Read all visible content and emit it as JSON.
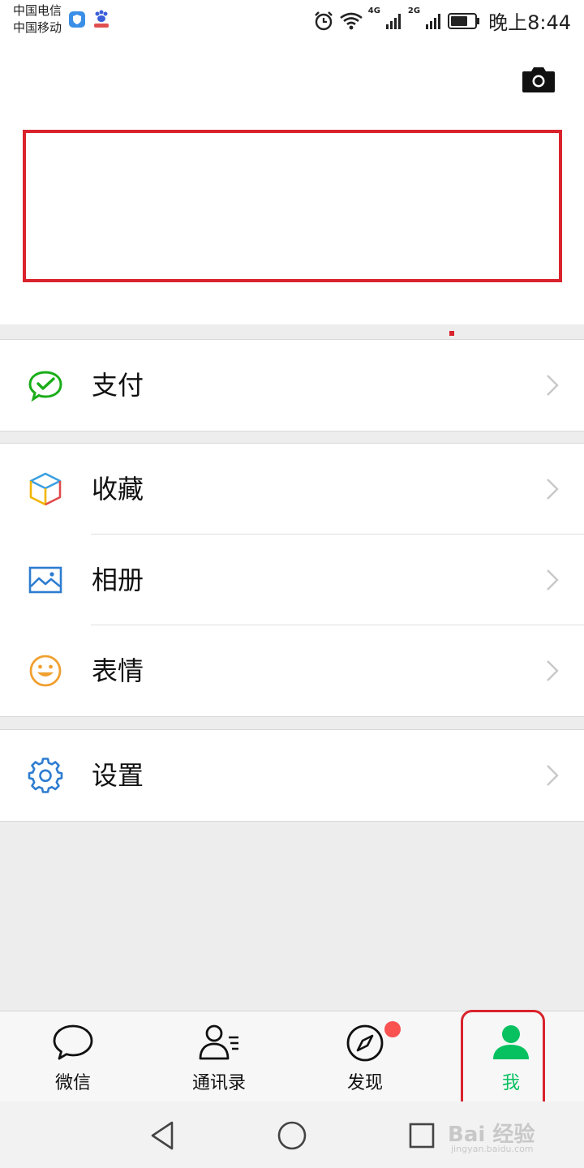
{
  "status_bar": {
    "carrier_1": "中国电信",
    "carrier_2": "中国移动",
    "net_1": "4G",
    "net_2": "2G",
    "time": "晚上8:44",
    "battery_level": 0.7
  },
  "header": {
    "camera_icon": "camera-icon"
  },
  "menu": {
    "group1": [
      {
        "label": "支付",
        "icon": "wechat-pay-icon",
        "color": "#1aad19"
      }
    ],
    "group2": [
      {
        "label": "收藏",
        "icon": "favorites-cube-icon",
        "color": "#f0b400"
      },
      {
        "label": "相册",
        "icon": "album-icon",
        "color": "#2d7cd1"
      },
      {
        "label": "表情",
        "icon": "sticker-smile-icon",
        "color": "#f0a030"
      }
    ],
    "group3": [
      {
        "label": "设置",
        "icon": "settings-gear-icon",
        "color": "#2d7cd1"
      }
    ]
  },
  "tabs": [
    {
      "label": "微信",
      "icon": "chat-bubble-icon",
      "active": false
    },
    {
      "label": "通讯录",
      "icon": "contacts-icon",
      "active": false
    },
    {
      "label": "发现",
      "icon": "compass-icon",
      "active": false,
      "badge": true
    },
    {
      "label": "我",
      "icon": "me-person-icon",
      "active": true
    }
  ],
  "colors": {
    "accent_green": "#07c160",
    "highlight_red": "#d9232d",
    "badge_red": "#fa5151"
  },
  "watermark": {
    "text": "Bai 经验",
    "sub": "jingyan.baidu.com"
  }
}
